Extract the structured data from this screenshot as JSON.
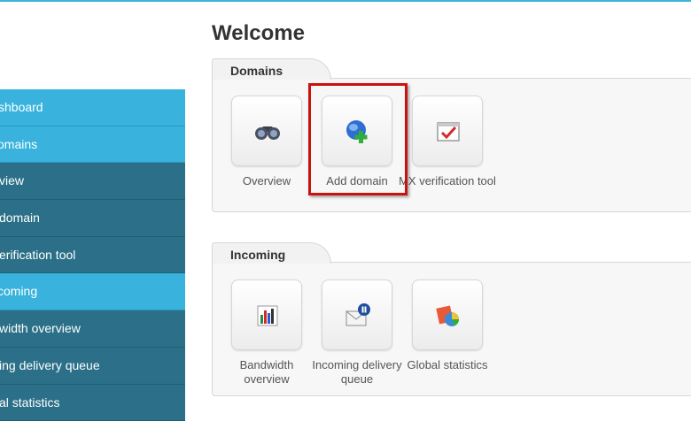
{
  "page": {
    "title": "Welcome"
  },
  "sidebar": {
    "items": [
      {
        "label": "shboard",
        "section": true
      },
      {
        "label": "omains",
        "section": true
      },
      {
        "label": "view",
        "section": false
      },
      {
        "label": "domain",
        "section": false
      },
      {
        "label": "erification tool",
        "section": false
      },
      {
        "label": "coming",
        "section": true
      },
      {
        "label": "width overview",
        "section": false
      },
      {
        "label": "ing delivery queue",
        "section": false
      },
      {
        "label": "al statistics",
        "section": false
      }
    ]
  },
  "domains": {
    "heading": "Domains",
    "tiles": [
      {
        "label": "Overview",
        "icon": "binoculars-icon"
      },
      {
        "label": "Add domain",
        "icon": "globe-add-icon"
      },
      {
        "label": "MX verification tool",
        "icon": "checklist-icon"
      }
    ]
  },
  "incoming": {
    "heading": "Incoming",
    "tiles": [
      {
        "label": "Bandwidth overview",
        "icon": "bar-chart-icon"
      },
      {
        "label": "Incoming delivery queue",
        "icon": "mail-queue-icon"
      },
      {
        "label": "Global statistics",
        "icon": "pie-chart-icon"
      }
    ]
  },
  "colors": {
    "sidebar_section": "#39b3dd",
    "sidebar_item": "#2b7088",
    "highlight": "#cc1111"
  }
}
